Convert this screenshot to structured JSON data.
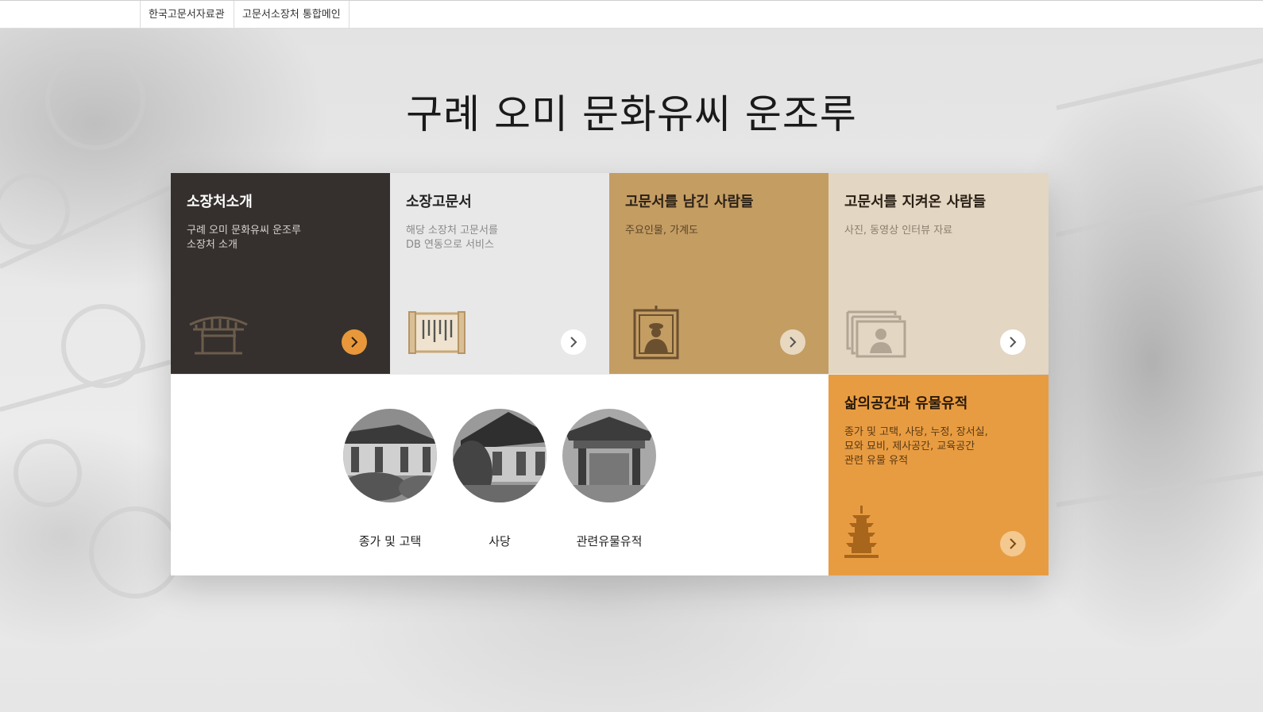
{
  "topbar": {
    "links": [
      {
        "label": "한국고문서자료관"
      },
      {
        "label": "고문서소장처 통합메인"
      }
    ]
  },
  "page": {
    "title": "구례 오미 문화유씨 운조루"
  },
  "cards": [
    {
      "title": "소장처소개",
      "desc": "구례 오미 문화유씨 운조루\n소장처 소개",
      "icon": "pavilion-icon"
    },
    {
      "title": "소장고문서",
      "desc": "해당 소장처 고문서를\nDB 연동으로 서비스",
      "icon": "scroll-icon"
    },
    {
      "title": "고문서를 남긴 사람들",
      "desc": "주요인물, 가계도",
      "icon": "portrait-icon"
    },
    {
      "title": "고문서를 지켜온 사람들",
      "desc": "사진, 동영상 인터뷰 자료",
      "icon": "photo-stack-icon"
    },
    {
      "title": "삶의공간과 유물유적",
      "desc": "종가 및 고택, 사당, 누정, 장서실,\n묘와 묘비, 제사공간, 교육공간\n관련 유물 유적",
      "icon": "pagoda-icon"
    }
  ],
  "gallery": {
    "items": [
      {
        "caption": "종가 및 고택"
      },
      {
        "caption": "사당"
      },
      {
        "caption": "관련유물유적"
      }
    ]
  },
  "colors": {
    "dark_card": "#35302d",
    "light_card": "#e8e8e8",
    "tan_card": "#c49d63",
    "beige_card": "#e3d6c2",
    "orange_card": "#e89c42",
    "accent_arrow": "#e8983a"
  }
}
